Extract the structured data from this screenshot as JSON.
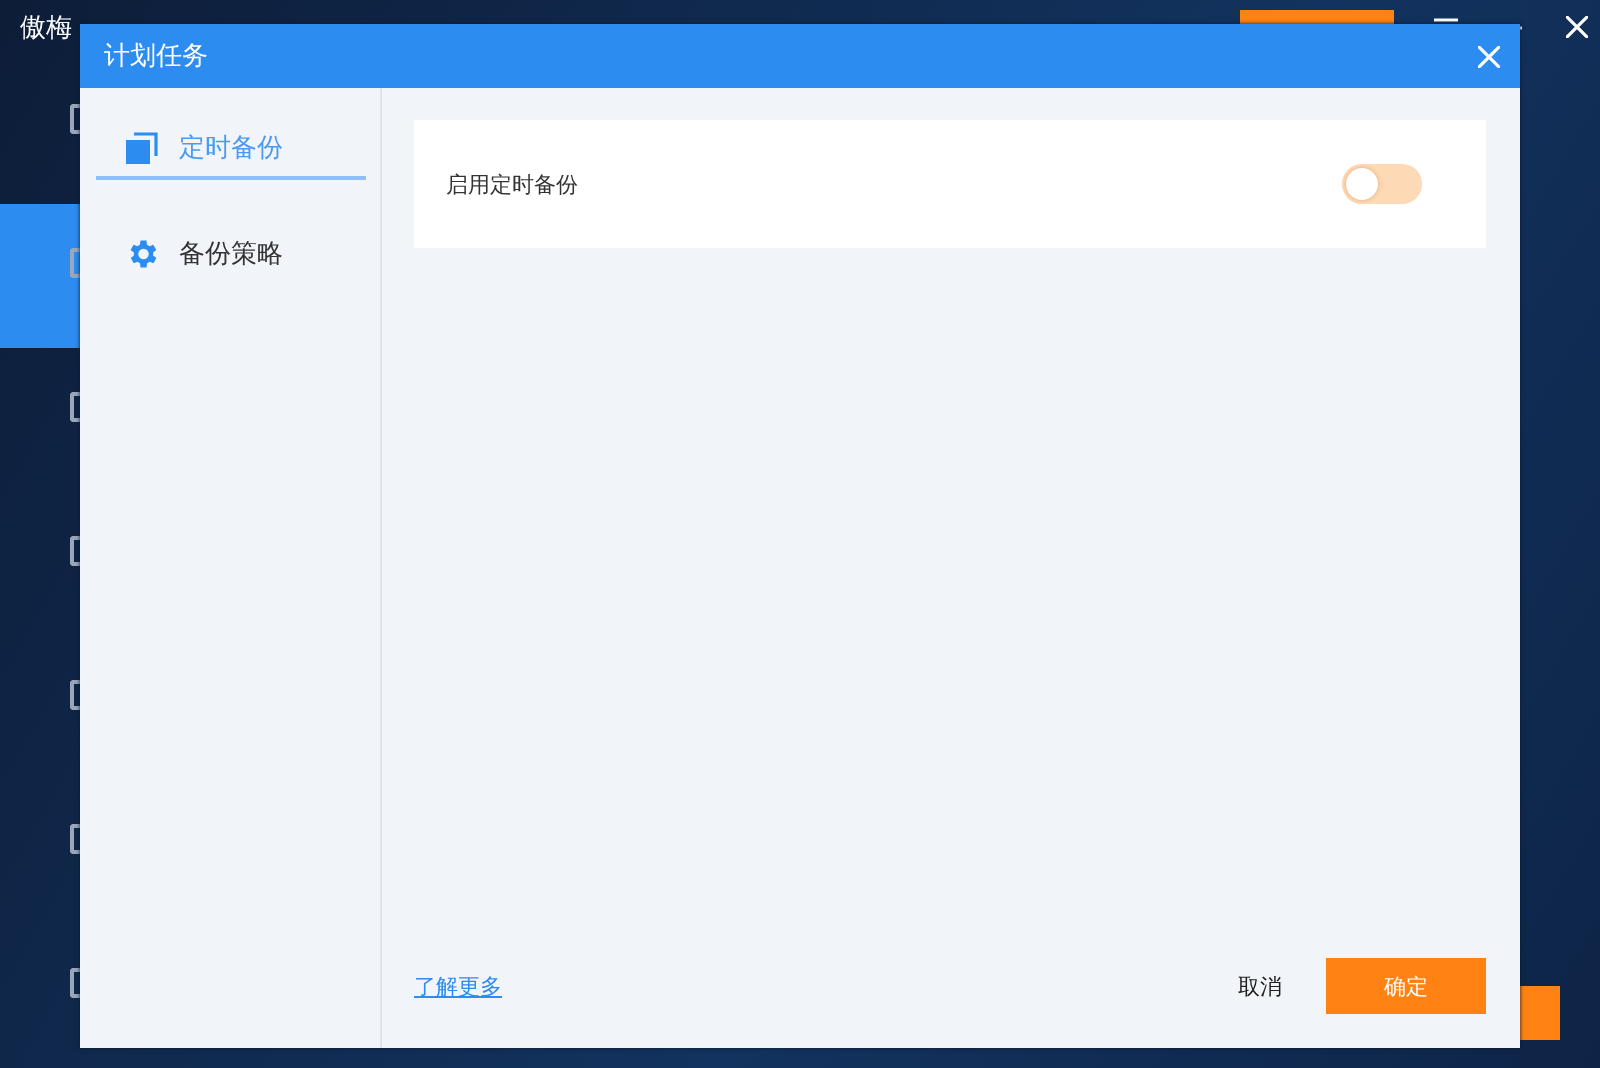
{
  "app": {
    "title": "傲梅"
  },
  "dialog": {
    "title": "计划任务",
    "nav": [
      {
        "label": "定时备份",
        "kind": "schedule",
        "selected": true
      },
      {
        "label": "备份策略",
        "kind": "strategy",
        "selected": false
      }
    ],
    "settings": [
      {
        "label": "启用定时备份",
        "on": false
      }
    ],
    "link": "了解更多",
    "buttons": [
      {
        "label": "取消",
        "kind": "secondary"
      },
      {
        "label": "确定",
        "kind": "primary"
      }
    ]
  }
}
